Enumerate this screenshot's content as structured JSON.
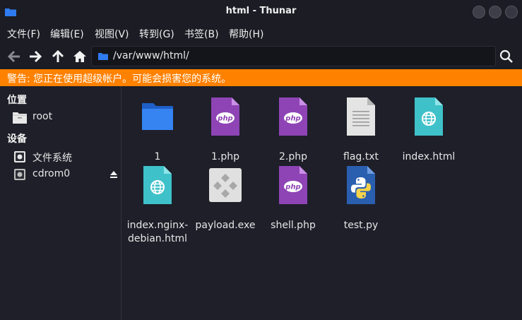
{
  "window": {
    "title": "html - Thunar"
  },
  "menu": [
    "文件(F)",
    "编辑(E)",
    "视图(V)",
    "转到(G)",
    "书签(B)",
    "帮助(H)"
  ],
  "location": {
    "path": "/var/www/html/"
  },
  "warning": "警告: 您正在使用超级帐户。可能会损害您的系统。",
  "sidebar": {
    "places_header": "位置",
    "places": [
      {
        "label": "root",
        "icon": "home-folder-icon"
      }
    ],
    "devices_header": "设备",
    "devices": [
      {
        "label": "文件系统",
        "icon": "drive-icon"
      },
      {
        "label": "cdrom0",
        "icon": "drive-icon"
      }
    ]
  },
  "files": [
    {
      "name": "1",
      "type": "folder"
    },
    {
      "name": "1.php",
      "type": "php"
    },
    {
      "name": "2.php",
      "type": "php"
    },
    {
      "name": "flag.txt",
      "type": "text"
    },
    {
      "name": "index.html",
      "type": "html"
    },
    {
      "name": "index.nginx-debian.html",
      "name_line1": "index.nginx-",
      "name_line2": "debian.html",
      "type": "html"
    },
    {
      "name": "payload.exe",
      "type": "exe"
    },
    {
      "name": "shell.php",
      "type": "php"
    },
    {
      "name": "test.py",
      "type": "python"
    }
  ],
  "colors": {
    "warning_bg": "#ff8100",
    "folder_blue": "#2f7bf0",
    "php_purple": "#8e44b5",
    "html_teal": "#3fc1c9",
    "python_blue": "#2a5fb0"
  }
}
